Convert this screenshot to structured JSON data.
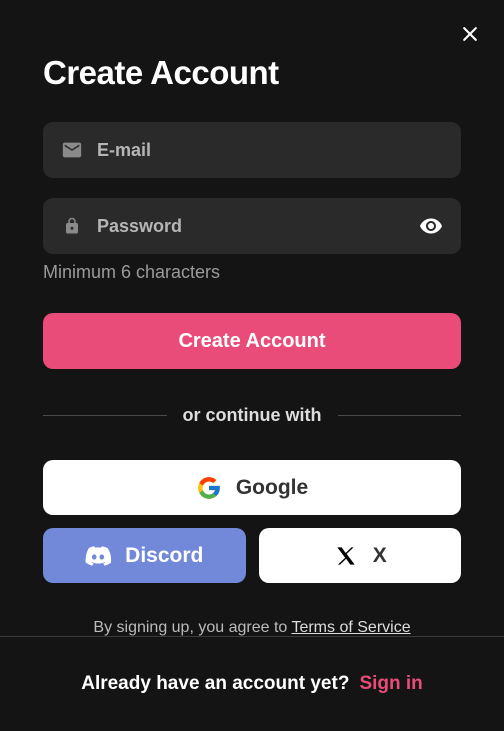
{
  "title": "Create Account",
  "fields": {
    "email": {
      "placeholder": "E-mail"
    },
    "password": {
      "placeholder": "Password"
    }
  },
  "helper": "Minimum 6 characters",
  "primary_button": "Create Account",
  "divider": "or continue with",
  "social": {
    "google": "Google",
    "discord": "Discord",
    "x": "X"
  },
  "terms": {
    "prefix": "By signing up, you agree to ",
    "link": "Terms of Service"
  },
  "footer": {
    "text": "Already have an account yet?",
    "link": "Sign in"
  }
}
